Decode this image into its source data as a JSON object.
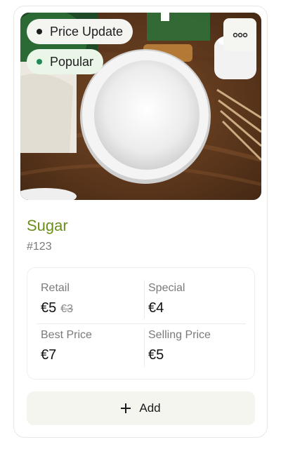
{
  "product": {
    "name": "Sugar",
    "sku": "#123",
    "image_alt": "Bowl of sugar on a wooden table",
    "tags": [
      {
        "label": "Price Update",
        "dot_color": "#1e1e1e"
      },
      {
        "label": "Popular",
        "dot_color": "#1e8a5a"
      }
    ],
    "more_icon": "more-horizontal-icon"
  },
  "prices": {
    "retail": {
      "label": "Retail",
      "value": "€5",
      "old_value": "€3"
    },
    "special": {
      "label": "Special",
      "value": "€4"
    },
    "best": {
      "label": "Best Price",
      "value": "€7"
    },
    "selling": {
      "label": "Selling Price",
      "value": "€5"
    }
  },
  "actions": {
    "add_label": "Add",
    "add_icon": "plus-icon"
  },
  "colors": {
    "title": "#6b8f1c",
    "popular_tag_bg": "#e9f6e8",
    "button_bg": "#f5f5f0"
  }
}
